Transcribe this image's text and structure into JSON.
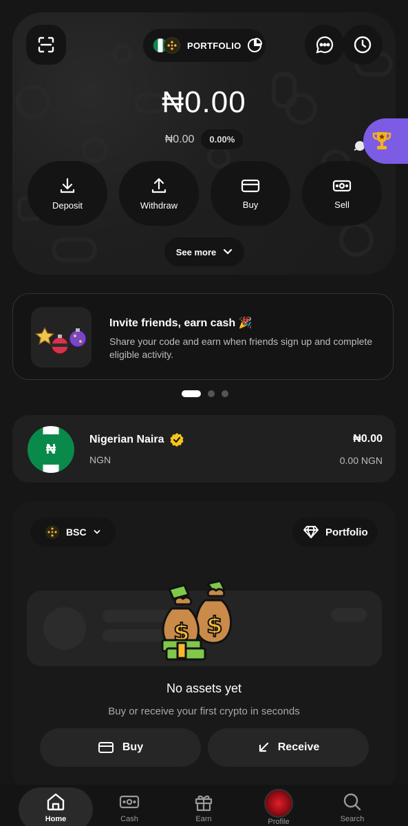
{
  "header": {
    "portfolio_label": "PORTFOLIO"
  },
  "balance": {
    "main": "₦0.00",
    "secondary": "₦0.00",
    "change_pct": "0.00%"
  },
  "actions": [
    {
      "label": "Deposit",
      "icon": "download-icon"
    },
    {
      "label": "Withdraw",
      "icon": "upload-icon"
    },
    {
      "label": "Buy",
      "icon": "card-icon"
    },
    {
      "label": "Sell",
      "icon": "cash-icon"
    }
  ],
  "see_more_label": "See more",
  "promo": {
    "title": "Invite friends, earn cash 🎉",
    "description": "Share your code and earn when friends sign up and complete eligible activity.",
    "pages": 3,
    "active_page": 1
  },
  "naira_account": {
    "name": "Nigerian Naira",
    "code": "NGN",
    "amount": "₦0.00",
    "amount_ngn": "0.00 NGN",
    "icon_symbol": "₦"
  },
  "assets": {
    "chain_label": "BSC",
    "portfolio_label": "Portfolio",
    "empty_title": "No assets yet",
    "empty_subtitle": "Buy or receive your first crypto in seconds",
    "buy_label": "Buy",
    "receive_label": "Receive"
  },
  "nav": [
    {
      "label": "Home",
      "icon": "home-icon",
      "active": true
    },
    {
      "label": "Cash",
      "icon": "cash-icon",
      "active": false
    },
    {
      "label": "Earn",
      "icon": "gift-icon",
      "active": false
    },
    {
      "label": "Profile",
      "icon": "avatar",
      "active": false
    },
    {
      "label": "Search",
      "icon": "search-icon",
      "active": false
    }
  ],
  "colors": {
    "background": "#161616",
    "accent_purple": "#7c5ce4",
    "naira_green": "#0a8a4a",
    "gold": "#f3ba2f"
  }
}
